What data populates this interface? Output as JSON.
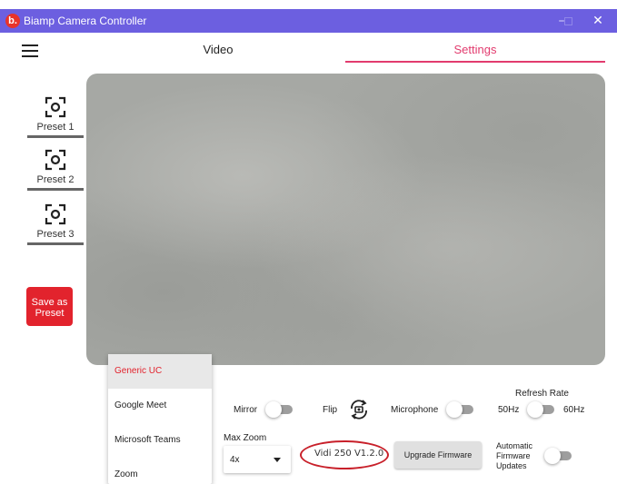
{
  "window": {
    "title": "Biamp Camera Controller",
    "logo_letter": "b.",
    "minimize": "–",
    "close": "✕"
  },
  "nav": {
    "tabs": [
      {
        "label": "Video"
      },
      {
        "label": "Settings",
        "active": true
      }
    ]
  },
  "presets": [
    {
      "label": "Preset 1",
      "icon": "focus-frame-icon"
    },
    {
      "label": "Preset 2",
      "icon": "focus-frame-icon"
    },
    {
      "label": "Preset 3",
      "icon": "focus-frame-icon"
    }
  ],
  "save_preset": {
    "label": "Save as Preset"
  },
  "dropdown": {
    "items": [
      "Generic UC",
      "Google Meet",
      "Microsoft Teams",
      "Zoom"
    ],
    "selected": "Generic UC"
  },
  "controls": {
    "mirror_label": "Mirror",
    "flip_label": "Flip",
    "microphone_label": "Microphone",
    "refresh_rate_label": "Refresh Rate",
    "refresh_low": "50Hz",
    "refresh_high": "60Hz",
    "max_zoom_label": "Max Zoom",
    "max_zoom_value": "4x",
    "firmware_version": "Vidi 250 V1.2.0",
    "upgrade_label": "Upgrade Firmware",
    "auto_update_label": "Automatic Firmware Updates"
  },
  "colors": {
    "titlebar": "#6c5fe0",
    "accent_pink": "#e23b6e",
    "save_red": "#e2232d",
    "annotation_red": "#c8202a"
  }
}
